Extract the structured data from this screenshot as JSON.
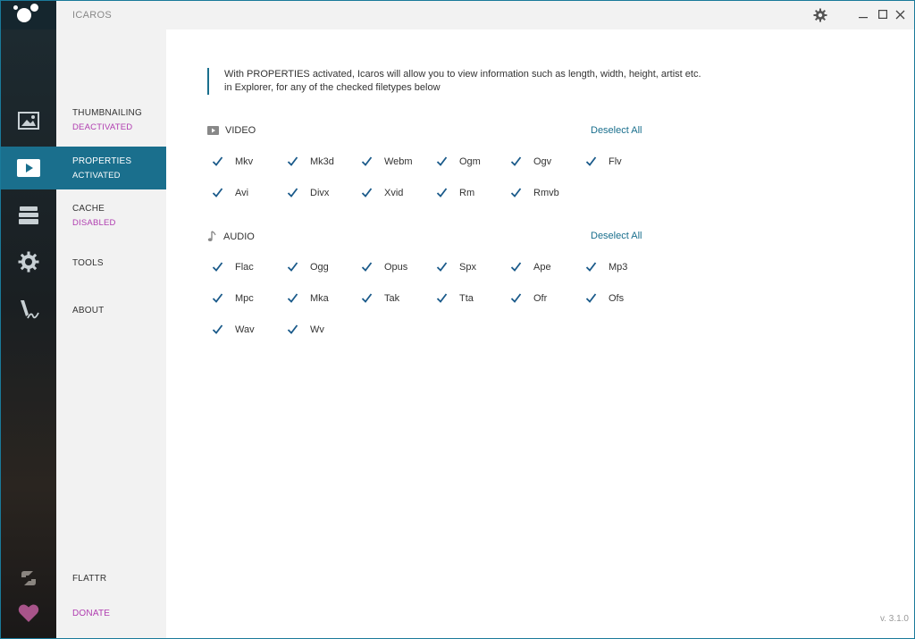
{
  "app": {
    "title": "ICAROS",
    "version": "v. 3.1.0",
    "accent": "#1a6f8d"
  },
  "titlebar": {
    "settings_icon": "gear-icon",
    "minimize_icon": "minimize-icon",
    "maximize_icon": "maximize-icon",
    "close_icon": "close-icon"
  },
  "nav": {
    "items": [
      {
        "label": "THUMBNAILING",
        "status": "DEACTIVATED",
        "status_color": "#b03db0",
        "icon": "image-icon",
        "active": false
      },
      {
        "label": "PROPERTIES",
        "status": "ACTIVATED",
        "status_color": "#ffffff",
        "icon": "play-icon",
        "active": true
      },
      {
        "label": "CACHE",
        "status": "DISABLED",
        "status_color": "#b03db0",
        "icon": "stack-icon",
        "active": false
      },
      {
        "label": "TOOLS",
        "status": "",
        "icon": "gear-icon",
        "active": false
      },
      {
        "label": "ABOUT",
        "status": "",
        "icon": "signature-icon",
        "active": false
      }
    ],
    "flattr": {
      "label": "FLATTR",
      "icon": "flattr-icon"
    },
    "donate": {
      "label": "DONATE",
      "icon": "heart-icon",
      "color": "#b03db0"
    }
  },
  "main": {
    "intro": "With  PROPERTIES  activated, Icaros will allow you to view information such as length, width, height, artist etc. in Explorer, for any of the checked filetypes below",
    "video": {
      "title": "VIDEO",
      "icon": "video-icon",
      "deselect_label": "Deselect All",
      "items": [
        {
          "label": "Mkv",
          "checked": true
        },
        {
          "label": "Mk3d",
          "checked": true
        },
        {
          "label": "Webm",
          "checked": true
        },
        {
          "label": "Ogm",
          "checked": true
        },
        {
          "label": "Ogv",
          "checked": true
        },
        {
          "label": "Flv",
          "checked": true
        },
        {
          "label": "Avi",
          "checked": true
        },
        {
          "label": "Divx",
          "checked": true
        },
        {
          "label": "Xvid",
          "checked": true
        },
        {
          "label": "Rm",
          "checked": true
        },
        {
          "label": "Rmvb",
          "checked": true
        }
      ]
    },
    "audio": {
      "title": "AUDIO",
      "icon": "music-note-icon",
      "deselect_label": "Deselect All",
      "items": [
        {
          "label": "Flac",
          "checked": true
        },
        {
          "label": "Ogg",
          "checked": true
        },
        {
          "label": "Opus",
          "checked": true
        },
        {
          "label": "Spx",
          "checked": true
        },
        {
          "label": "Ape",
          "checked": true
        },
        {
          "label": "Mp3",
          "checked": true
        },
        {
          "label": "Mpc",
          "checked": true
        },
        {
          "label": "Mka",
          "checked": true
        },
        {
          "label": "Tak",
          "checked": true
        },
        {
          "label": "Tta",
          "checked": true
        },
        {
          "label": "Ofr",
          "checked": true
        },
        {
          "label": "Ofs",
          "checked": true
        },
        {
          "label": "Wav",
          "checked": true
        },
        {
          "label": "Wv",
          "checked": true
        }
      ]
    }
  }
}
